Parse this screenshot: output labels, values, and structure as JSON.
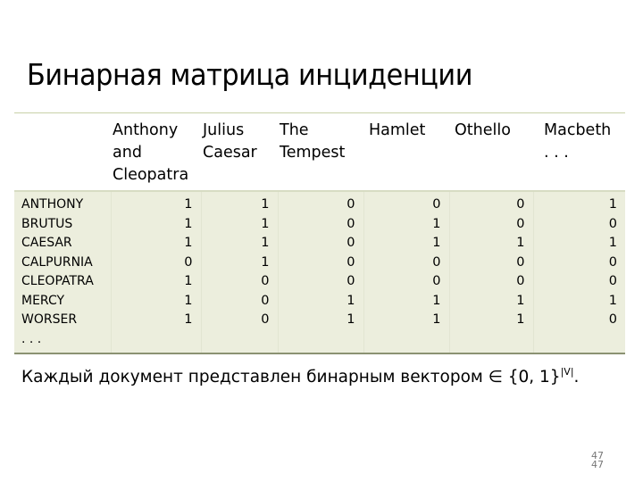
{
  "slide": {
    "title": "Бинарная матрица инциденции",
    "caption": "Каждый документ представлен бинарным вектором ∈ {0, 1}",
    "caption_sup": "|V|",
    "caption_end": ".",
    "page_number": "47"
  },
  "table": {
    "columns": [
      {
        "lines": [
          "Anthony",
          "and",
          "Cleopatra"
        ]
      },
      {
        "lines": [
          "Julius",
          "Caesar"
        ]
      },
      {
        "lines": [
          "The",
          "Tempest"
        ]
      },
      {
        "lines": [
          "Hamlet"
        ]
      },
      {
        "lines": [
          "Othello"
        ]
      },
      {
        "lines": [
          "Macbeth",
          ". . ."
        ]
      }
    ],
    "terms": [
      "ANTHONY",
      "BRUTUS",
      "CAESAR",
      "CALPURNIA",
      "CLEOPATRA",
      "MERCY",
      "WORSER",
      ". . ."
    ],
    "matrix": [
      [
        "1",
        "1",
        "1",
        "0",
        "1",
        "1",
        "1"
      ],
      [
        "1",
        "1",
        "1",
        "1",
        "0",
        "0",
        "0"
      ],
      [
        "0",
        "0",
        "0",
        "0",
        "0",
        "1",
        "1"
      ],
      [
        "0",
        "1",
        "1",
        "0",
        "0",
        "1",
        "1"
      ],
      [
        "0",
        "0",
        "1",
        "0",
        "0",
        "1",
        "1"
      ],
      [
        "1",
        "0",
        "1",
        "0",
        "0",
        "1",
        "0"
      ]
    ]
  }
}
